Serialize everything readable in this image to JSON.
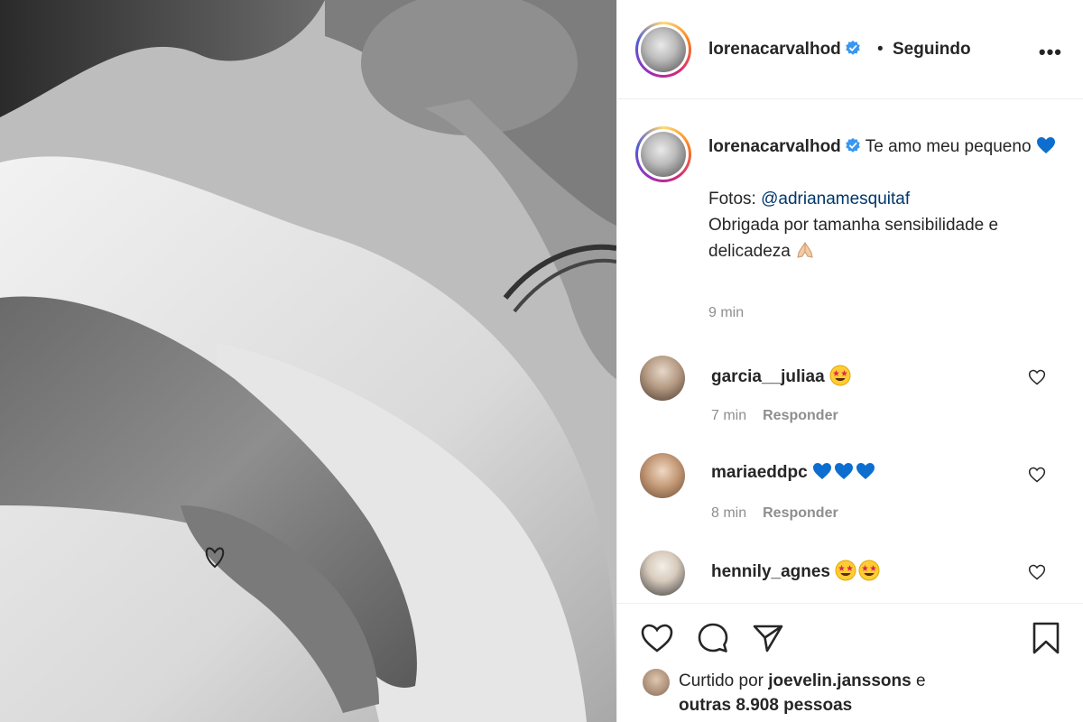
{
  "post": {
    "author": "lorenacarvalhod",
    "follow_separator": "•",
    "follow_status": "Seguindo",
    "more_label": "•••"
  },
  "caption": {
    "author": "lorenacarvalhod",
    "line1": "Te amo meu pequeno",
    "photos_prefix": "Fotos:",
    "mention": "@adrianamesquitaf",
    "line2": "Obrigada por tamanha sensibilidade e delicadeza",
    "time": "9 min"
  },
  "comments": [
    {
      "user": "garcia__juliaa",
      "emoji": "star-struck-face",
      "time": "7 min",
      "reply": "Responder"
    },
    {
      "user": "mariaeddpc",
      "emoji": "blue-hearts-x3",
      "time": "8 min",
      "reply": "Responder"
    },
    {
      "user": "hennily_agnes",
      "emoji": "star-struck-face-x2",
      "time": "",
      "reply": ""
    }
  ],
  "likes": {
    "prefix": "Curtido por",
    "user": "joevelin.janssons",
    "connector": "e",
    "others": "outras 8.908 pessoas"
  },
  "colors": {
    "mention": "#00376b",
    "verified": "#3897f0",
    "emoji_blue_heart": "#0d6ed0",
    "muted": "#8e8e8e"
  }
}
